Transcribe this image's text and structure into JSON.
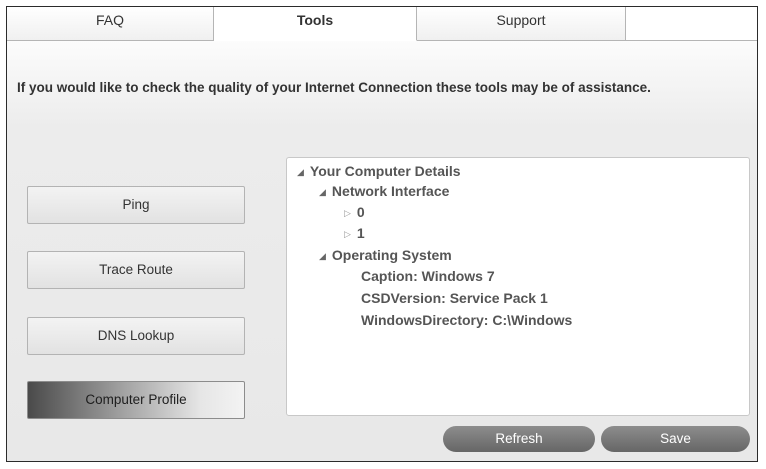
{
  "tabs": [
    {
      "label": "FAQ"
    },
    {
      "label": "Tools"
    },
    {
      "label": "Support"
    }
  ],
  "intro_text": "If you would like to check the quality of your Internet Connection these tools may be of assistance.",
  "side_buttons": [
    {
      "label": "Ping"
    },
    {
      "label": "Trace Route"
    },
    {
      "label": "DNS Lookup"
    },
    {
      "label": "Computer Profile"
    }
  ],
  "tree": {
    "root": "Your Computer Details",
    "network_interface": {
      "label": "Network Interface",
      "items": [
        "0",
        "1"
      ]
    },
    "operating_system": {
      "label": "Operating System",
      "caption": "Caption: Windows 7",
      "csd_version": "CSDVersion: Service Pack 1",
      "windows_directory": "WindowsDirectory: C:\\Windows"
    }
  },
  "actions": {
    "refresh": "Refresh",
    "save": "Save"
  }
}
